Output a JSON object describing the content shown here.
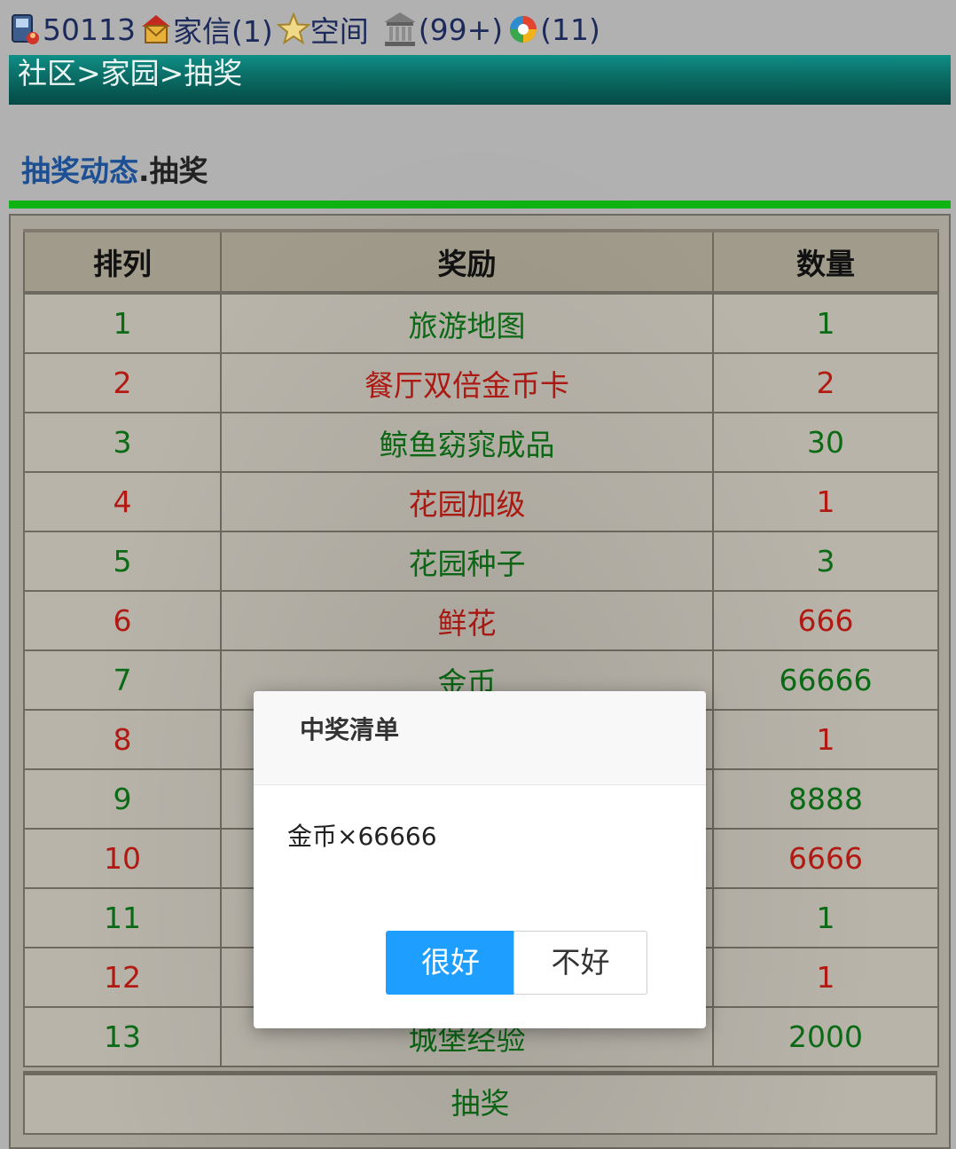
{
  "topbar": {
    "user_id": "50113",
    "mail_label": "家信(1)",
    "space_label": "空间",
    "bank_count": "(99+)",
    "photo_count": "(11)"
  },
  "breadcrumb": "社区>家园>抽奖",
  "section": {
    "link_text": "抽奖动态",
    "sep": ".",
    "title": "抽奖"
  },
  "table": {
    "headers": [
      "排列",
      "奖励",
      "数量"
    ],
    "rows": [
      {
        "rank": "1",
        "reward": "旅游地图",
        "qty": "1",
        "color": "green"
      },
      {
        "rank": "2",
        "reward": "餐厅双倍金币卡",
        "qty": "2",
        "color": "red"
      },
      {
        "rank": "3",
        "reward": "鲸鱼窈窕成品",
        "qty": "30",
        "color": "green"
      },
      {
        "rank": "4",
        "reward": "花园加级",
        "qty": "1",
        "color": "red"
      },
      {
        "rank": "5",
        "reward": "花园种子",
        "qty": "3",
        "color": "green"
      },
      {
        "rank": "6",
        "reward": "鲜花",
        "qty": "666",
        "color": "red"
      },
      {
        "rank": "7",
        "reward": "金币",
        "qty": "66666",
        "color": "green"
      },
      {
        "rank": "8",
        "reward": "",
        "qty": "1",
        "color": "red"
      },
      {
        "rank": "9",
        "reward": "",
        "qty": "8888",
        "color": "green"
      },
      {
        "rank": "10",
        "reward": "",
        "qty": "6666",
        "color": "red"
      },
      {
        "rank": "11",
        "reward": "",
        "qty": "1",
        "color": "green"
      },
      {
        "rank": "12",
        "reward": "",
        "qty": "1",
        "color": "red"
      },
      {
        "rank": "13",
        "reward": "城堡经验",
        "qty": "2000",
        "color": "green"
      }
    ],
    "draw_button": "抽奖"
  },
  "dialog": {
    "title": "中奖清单",
    "message": "金币×66666",
    "ok_label": "很好",
    "cancel_label": "不好"
  },
  "colors": {
    "green_text": "#0b6b15",
    "red_text": "#b21a12",
    "banner": "#0b6f68",
    "accent_line": "#0fb313",
    "ok_button": "#1e9fff"
  }
}
